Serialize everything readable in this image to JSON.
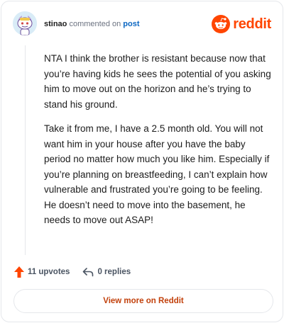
{
  "header": {
    "username": "stinao",
    "commented_text": "commented on",
    "post_link": "post",
    "brand": "reddit",
    "avatar_icon": "snoo-avatar-icon",
    "brand_icon": "reddit-logo-icon",
    "brand_color": "#ff4500"
  },
  "comment": {
    "paragraphs": [
      "NTA I think the brother is resistant because now that you’re having kids he sees the potential of you asking him to move out on the horizon and he’s trying to stand his ground.",
      "Take it from me, I have a 2.5 month old. You will not want him in your house after you have the baby period no matter how much you like him. Especially if you’re planning on breastfeeding, I can’t explain how vulnerable and frustrated you’re going to be feeling. He doesn’t need to move into the basement, he needs to move out ASAP!"
    ]
  },
  "actions": {
    "upvotes": "11 upvotes",
    "replies": "0 replies",
    "upvote_icon": "upvote-arrow-icon",
    "reply_icon": "reply-arrow-icon",
    "upvote_color": "#ff4500"
  },
  "footer": {
    "view_more": "View more on Reddit"
  }
}
